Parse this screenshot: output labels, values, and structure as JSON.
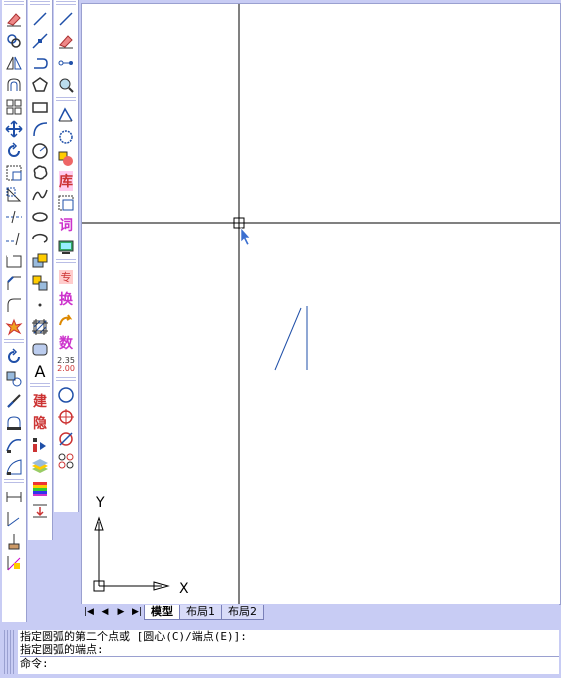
{
  "toolbars": {
    "modify": [
      "erase-icon",
      "copy-icon",
      "mirror-icon",
      "offset-icon",
      "array-icon",
      "move-icon",
      "rotate-icon",
      "scale-icon",
      "stretch-icon",
      "trim-icon",
      "extend-icon",
      "break-icon",
      "chamfer-icon",
      "fillet-icon",
      "explode-icon"
    ],
    "modify2": [
      "undo-icon",
      "properties-icon",
      "match-icon",
      "edit-polyline-icon",
      "edit-spline-icon",
      "edit-hatch-icon"
    ],
    "draw": [
      "line-icon",
      "ray-icon",
      "polyline-icon",
      "polygon-icon",
      "rectangle-icon",
      "arc-icon",
      "circle-icon",
      "revcloud-icon",
      "spline-icon",
      "ellipse-icon",
      "ellipse-arc-icon",
      "insert-block-icon",
      "make-block-icon",
      "point-icon",
      "hatch-icon",
      "region-icon",
      "text-icon"
    ],
    "extra": [
      "build-icon",
      "hide-icon",
      "layer-icon",
      "layer-state-icon",
      "color-icon",
      "dimension-icon"
    ],
    "tools": [
      "line2-icon",
      "eraser2-icon",
      "snap-icon",
      "zoom-icon",
      "polygon2-icon",
      "circle-dash-icon",
      "block-lib-icon",
      "library-icon",
      "frame-icon",
      "word-icon",
      "screen-icon",
      "convert-icon",
      "swap-icon",
      "arrow-icon",
      "number-icon",
      "scale-num-icon",
      "circle2-icon",
      "target-icon",
      "cross-circle-icon",
      "group-icon"
    ],
    "dims": [
      "linear-dim-icon",
      "aligned-dim-icon",
      "ordinate-dim-icon",
      "dim-style-icon"
    ],
    "text_labels": {
      "text": "A",
      "build": "建",
      "hide": "隐",
      "library": "库",
      "word": "词",
      "convert": "换",
      "number": "数",
      "scale_top": "2.35",
      "scale_bottom": "2.00"
    }
  },
  "ucs": {
    "x_label": "X",
    "y_label": "Y"
  },
  "tabs": {
    "nav": [
      "|◀",
      "◀",
      "▶",
      "▶|"
    ],
    "items": [
      {
        "label": "模型",
        "active": true
      },
      {
        "label": "布局1",
        "active": false
      },
      {
        "label": "布局2",
        "active": false
      }
    ]
  },
  "command": {
    "lines": [
      "指定圆弧的第二个点或 [圆心(C)/端点(E)]:",
      "指定圆弧的端点:",
      "命令:"
    ]
  },
  "colors": {
    "accent": "#1f4fa8",
    "bg": "#c8ccf4",
    "arc": "#1f4fa8"
  }
}
